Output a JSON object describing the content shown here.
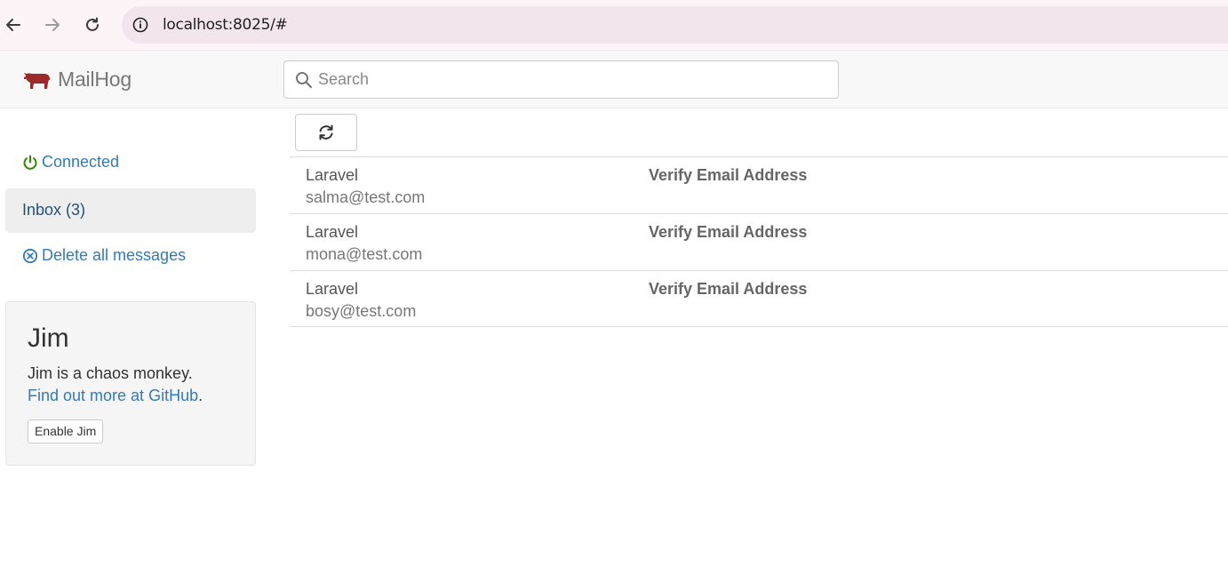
{
  "browser": {
    "url": "localhost:8025/#",
    "icons": [
      "back-arrow-icon",
      "forward-arrow-icon",
      "reload-icon",
      "info-icon"
    ]
  },
  "header": {
    "brand": "MailHog",
    "search_placeholder": "Search"
  },
  "sidebar": {
    "connected_label": "Connected",
    "inbox_label": "Inbox (3)",
    "delete_all_label": "Delete all messages"
  },
  "jim": {
    "title": "Jim",
    "description": "Jim is a chaos monkey.",
    "link_label": "Find out more at GitHub",
    "link_suffix": ".",
    "button_label": "Enable Jim"
  },
  "messages": [
    {
      "from": "Laravel",
      "to": "salma@test.com",
      "subject": "Verify Email Address"
    },
    {
      "from": "Laravel",
      "to": "mona@test.com",
      "subject": "Verify Email Address"
    },
    {
      "from": "Laravel",
      "to": "bosy@test.com",
      "subject": "Verify Email Address"
    }
  ],
  "colors": {
    "link": "#337ab7",
    "connected": "#2e8b00",
    "logo": "#9b2a2a"
  }
}
